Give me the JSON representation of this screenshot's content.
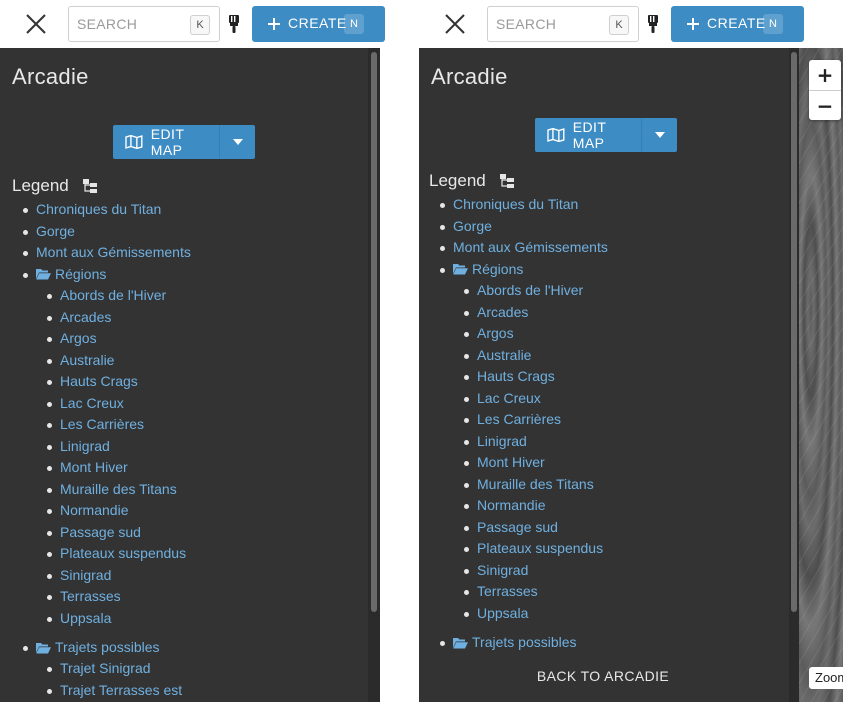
{
  "header": {
    "search_placeholder": "SEARCH",
    "search_shortcut": "K",
    "create_label": "CREATE",
    "create_shortcut": "N"
  },
  "map": {
    "zoom_in": "+",
    "zoom_out": "−",
    "zoom_label": "Zoom"
  },
  "panel": {
    "title": "Arcadie",
    "edit_map_label": "EDIT MAP",
    "legend_label": "Legend",
    "back_label": "BACK TO ARCADIE"
  },
  "legend": {
    "top_items": [
      "Chroniques du Titan",
      "Gorge",
      "Mont aux Gémissements"
    ],
    "regions_label": "Régions",
    "regions": [
      "Abords de l'Hiver",
      "Arcades",
      "Argos",
      "Australie",
      "Hauts Crags",
      "Lac Creux",
      "Les Carrières",
      "Linigrad",
      "Mont Hiver",
      "Muraille des Titans",
      "Normandie",
      "Passage sud",
      "Plateaux suspendus",
      "Sinigrad",
      "Terrasses",
      "Uppsala"
    ],
    "trajets_label": "Trajets possibles",
    "trajets": [
      "Trajet Sinigrad",
      "Trajet Terrasses est"
    ]
  },
  "colors": {
    "accent": "#3d8cc4",
    "panel_bg": "#333333",
    "link": "#6fb0e0"
  }
}
